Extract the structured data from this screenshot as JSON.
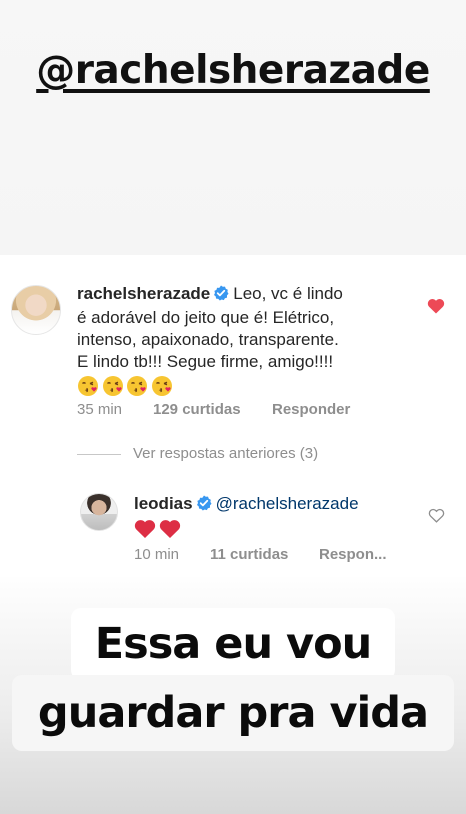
{
  "story": {
    "handle": "@rachelsherazade",
    "caption_line1": "Essa eu vou",
    "caption_line2": "guardar pra vida"
  },
  "comment": {
    "username": "rachelsherazade",
    "verified": true,
    "text_line1": "Leo, vc é lindo",
    "text_line2": "é adorável do jeito que é! Elétrico,",
    "text_line3": "intenso, apaixonado,  transparente.",
    "text_line4": "E lindo tb!!! Segue firme, amigo!!!!",
    "emojis": [
      "kissing-heart",
      "kissing-heart",
      "kissing-heart",
      "kissing-heart"
    ],
    "time": "35 min",
    "likes": "129 curtidas",
    "reply_label": "Responder",
    "liked": true
  },
  "view_previous": "Ver respostas anteriores (3)",
  "reply": {
    "username": "leodias",
    "verified": true,
    "mention": "@rachelsherazade",
    "emojis": [
      "red-heart",
      "red-heart"
    ],
    "time": "10 min",
    "likes": "11 curtidas",
    "reply_label": "Respon...",
    "liked": false
  },
  "colors": {
    "text": "#262626",
    "meta": "#8e8e8e",
    "verified": "#3897f0",
    "like": "#ed4956",
    "mention": "#00376b"
  }
}
